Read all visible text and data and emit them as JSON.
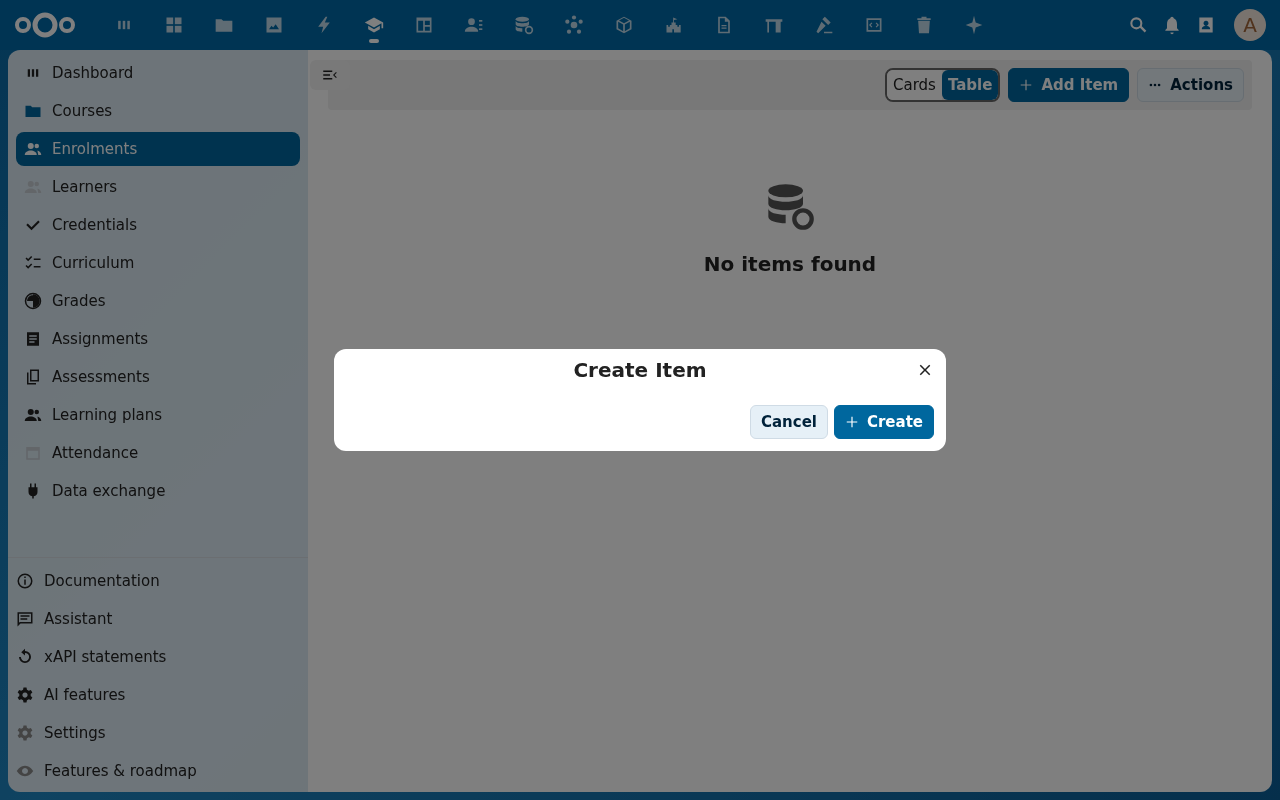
{
  "header": {
    "apps": [
      {
        "selected": false
      },
      {
        "selected": false
      },
      {
        "selected": false
      },
      {
        "selected": false
      },
      {
        "selected": false
      },
      {
        "selected": true
      },
      {
        "selected": false
      },
      {
        "selected": false
      },
      {
        "selected": false
      },
      {
        "selected": false
      },
      {
        "selected": false
      },
      {
        "selected": false
      },
      {
        "selected": false
      },
      {
        "selected": false
      },
      {
        "selected": false
      },
      {
        "selected": false
      },
      {
        "selected": false
      },
      {
        "selected": false
      }
    ],
    "avatar": "A"
  },
  "sidebar": {
    "items": [
      {
        "label": "Dashboard",
        "selected": false
      },
      {
        "label": "Courses",
        "selected": false
      },
      {
        "label": "Enrolments",
        "selected": true
      },
      {
        "label": "Learners",
        "selected": false
      },
      {
        "label": "Credentials",
        "selected": false
      },
      {
        "label": "Curriculum",
        "selected": false
      },
      {
        "label": "Grades",
        "selected": false
      },
      {
        "label": "Assignments",
        "selected": false
      },
      {
        "label": "Assessments",
        "selected": false
      },
      {
        "label": "Learning plans",
        "selected": false
      },
      {
        "label": "Attendance",
        "selected": false
      },
      {
        "label": "Data exchange",
        "selected": false
      }
    ],
    "footer_items": [
      {
        "label": "Documentation"
      },
      {
        "label": "Assistant"
      },
      {
        "label": "xAPI statements"
      },
      {
        "label": "AI features"
      },
      {
        "label": "Settings"
      },
      {
        "label": "Features & roadmap"
      }
    ]
  },
  "toolbar": {
    "view_toggle": [
      {
        "label": "Cards",
        "selected": false
      },
      {
        "label": "Table",
        "selected": true
      }
    ],
    "add_button": "Add Item",
    "actions_button": "Actions"
  },
  "empty_state": {
    "message": "No items found"
  },
  "dialog": {
    "title": "Create Item",
    "buttons": [
      {
        "label": "Cancel",
        "kind": "secondary"
      },
      {
        "label": "Create",
        "kind": "primary"
      }
    ]
  }
}
